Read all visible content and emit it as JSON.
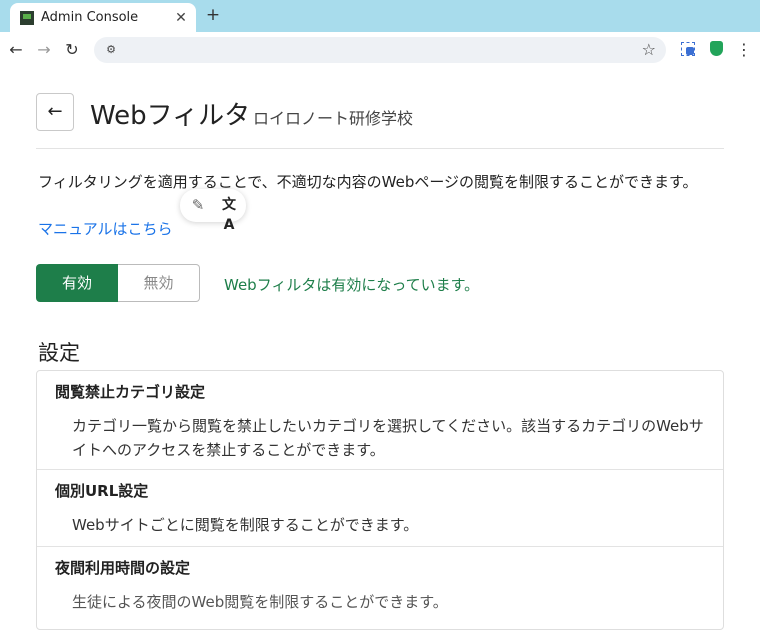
{
  "browser": {
    "tab_title": "Admin Console",
    "tab_close": "✕",
    "new_tab": "+",
    "address_url": "",
    "icons": [
      "back-icon",
      "forward-icon",
      "reload-icon",
      "site-info-icon",
      "star-icon",
      "extension-icon",
      "shield-icon",
      "menu-icon"
    ]
  },
  "header": {
    "back_icon": "←",
    "title": "Webフィルタ",
    "org_name": "ロイロノート研修学校"
  },
  "intro": {
    "description": "フィルタリングを適用することで、不適切な内容のWebページの閲覧を制限することができます。",
    "manual_link": "マニュアルはこちら"
  },
  "floating_tools": {
    "magic_icon": "✎",
    "translate_icon": "文A"
  },
  "filter_toggle": {
    "on_label": "有効",
    "off_label": "無効",
    "selected": "有効",
    "status_text": "Webフィルタは有効になっています。",
    "accent_color": "#1e7e4a"
  },
  "settings": {
    "title": "設定",
    "items": [
      {
        "title": "閲覧禁止カテゴリ設定",
        "description": "カテゴリ一覧から閲覧を禁止したいカテゴリを選択してください。該当するカテゴリのWebサイトへのアクセスを禁止することができます。"
      },
      {
        "title": "個別URL設定",
        "description": "Webサイトごとに閲覧を制限することができます。"
      },
      {
        "title": "夜間利用時間の設定",
        "description": "生徒による夜間のWeb閲覧を制限することができます。"
      }
    ]
  }
}
